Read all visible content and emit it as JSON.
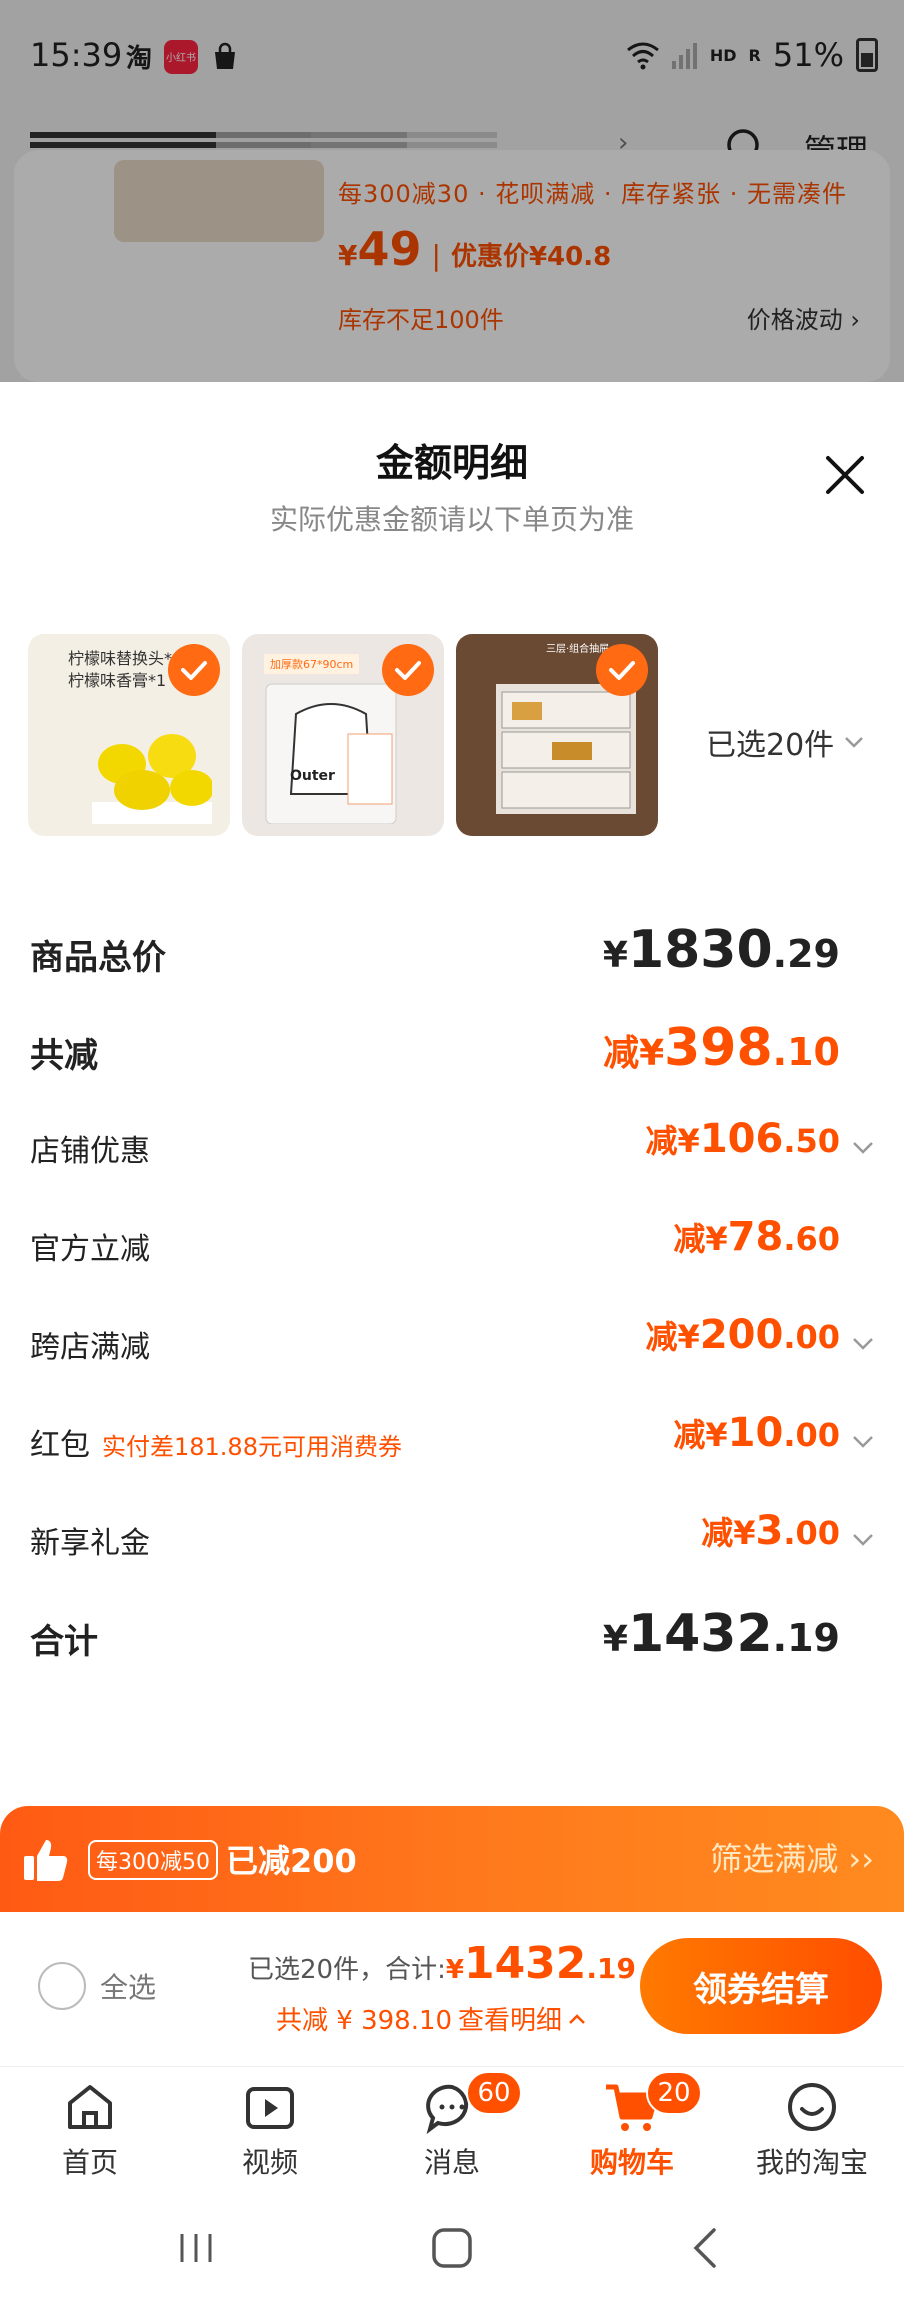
{
  "status_bar": {
    "time": "15:39",
    "taobao_glyph": "淘",
    "xhs_label": "小红书",
    "hd_label": "HD",
    "r_label": "R",
    "battery": "51%"
  },
  "background_page": {
    "manage_label": "管理",
    "promo_text": "每300减30 · 花呗满减 · 库存紧张 · 无需凑件",
    "price": "49",
    "price_yen": "¥",
    "coupon_price_label": "优惠价¥40.8",
    "stock_warning": "库存不足100件",
    "price_fluctuation": "价格波动"
  },
  "sheet": {
    "title": "金额明细",
    "subtitle": "实际优惠金额请以下单页为准",
    "thumb1_text_line1": "柠檬味替换头*40",
    "thumb1_text_line2": "柠檬味香膏*1",
    "thumb2_tag": "加厚款67*90cm",
    "thumb2_outer": "Outer",
    "thumb3_tag": "三层·组合抽屉",
    "selected_count": "已选20件",
    "rows": [
      {
        "label": "商品总价",
        "prefix": "¥",
        "int": "1830",
        "dec": ".29"
      },
      {
        "label": "共减",
        "prefix": "减¥",
        "int": "398",
        "dec": ".10"
      },
      {
        "label": "店铺优惠",
        "prefix": "减¥",
        "int": "106",
        "dec": ".50"
      },
      {
        "label": "官方立减",
        "prefix": "减¥",
        "int": "78",
        "dec": ".60"
      },
      {
        "label": "跨店满减",
        "prefix": "减¥",
        "int": "200",
        "dec": ".00"
      },
      {
        "label": "红包",
        "hint": "实付差181.88元可用消费券",
        "prefix": "减¥",
        "int": "10",
        "dec": ".00"
      },
      {
        "label": "新享礼金",
        "prefix": "减¥",
        "int": "3",
        "dec": ".00"
      },
      {
        "label": "合计",
        "prefix": "¥",
        "int": "1432",
        "dec": ".19"
      }
    ]
  },
  "promo_banner": {
    "tag": "每300减50",
    "saved": "已减200",
    "filter": "筛选满减"
  },
  "checkout": {
    "select_all": "全选",
    "summary_prefix": "已选20件，合计:",
    "total_yen": "¥",
    "total_int": "1432",
    "total_dec": ".19",
    "discount_line": "共减 ¥ 398.10",
    "details_link": "查看明细",
    "button": "领券结算"
  },
  "tabs": [
    {
      "label": "首页",
      "icon": "home-icon"
    },
    {
      "label": "视频",
      "icon": "video-icon"
    },
    {
      "label": "消息",
      "icon": "message-icon",
      "badge": "60"
    },
    {
      "label": "购物车",
      "icon": "cart-icon",
      "badge": "20",
      "active": true
    },
    {
      "label": "我的淘宝",
      "icon": "profile-icon"
    }
  ],
  "colors": {
    "accent": "#ff5000",
    "banner_start": "#ff5a14",
    "banner_end": "#ff8a1f"
  }
}
